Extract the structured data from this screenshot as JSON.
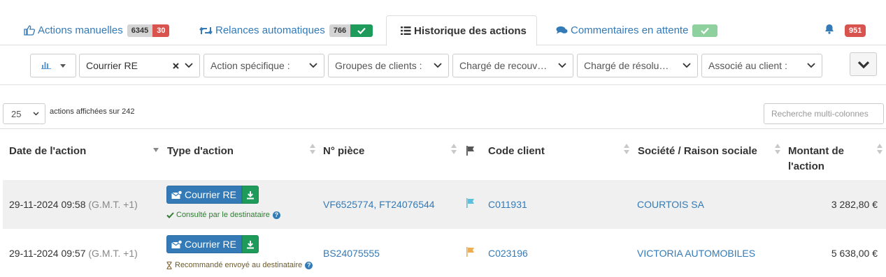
{
  "tabs": [
    {
      "label": "Actions manuelles",
      "icon": "thumbs-up-icon",
      "count": "6345",
      "alert": "30"
    },
    {
      "label": "Relances automatiques",
      "icon": "retweet-icon",
      "count": "766"
    },
    {
      "label": "Historique des actions",
      "icon": "list-icon"
    },
    {
      "label": "Commentaires en attente",
      "icon": "comments-icon"
    }
  ],
  "notifications": {
    "count": "951",
    "icon": "bell-icon"
  },
  "filters": {
    "chart_icon": "bar-chart-icon",
    "courrier": "Courrier RE",
    "action": "Action spécifique :",
    "groupes": "Groupes de clients :",
    "charge_recouv": "Chargé de recouv…",
    "charge_resol": "Chargé de résolu…",
    "associe": "Associé au client :"
  },
  "controls": {
    "page_size": "25",
    "shown_text": "actions affichées sur 242",
    "search_placeholder": "Recherche multi-colonnes"
  },
  "columns": {
    "date": "Date de l'action",
    "type": "Type d'action",
    "piece": "N° pièce",
    "code": "Code client",
    "societe": "Société / Raison sociale",
    "montant_1": "Montant de",
    "montant_2": "l'action"
  },
  "rows": [
    {
      "date": "29-11-2024 09:58",
      "tz": "(G.M.T. +1)",
      "action_label": "Courrier RE",
      "status": "Consulté par le destinataire",
      "status_kind": "ok",
      "piece": "VF6525774, FT24076544",
      "flag_color": "#5bc0de",
      "code": "C011931",
      "societe": "COURTOIS SA",
      "montant": "3 282,80 €"
    },
    {
      "date": "29-11-2024 09:57",
      "tz": "(G.M.T. +1)",
      "action_label": "Courrier RE",
      "status": "Recommandé envoyé au destinataire",
      "status_kind": "pending",
      "piece": "BS24075555",
      "flag_color": "#f0ad4e",
      "code": "C023196",
      "societe": "VICTORIA AUTOMOBILES",
      "montant": "5 638,00 €"
    }
  ],
  "colors": {
    "link": "#337ab7",
    "danger": "#d9534f",
    "success": "#1e9a5a",
    "row_stripe": "#f0f0f0"
  }
}
